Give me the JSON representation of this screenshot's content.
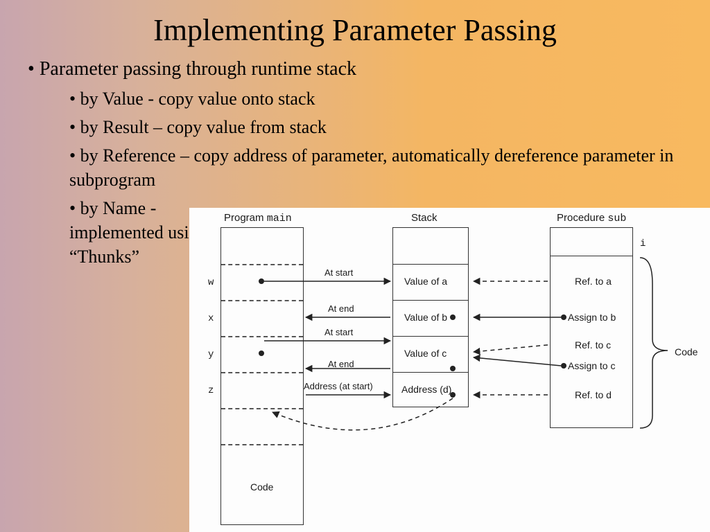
{
  "title": "Implementing Parameter Passing",
  "bullets": {
    "main": "Parameter passing through runtime stack",
    "sub": [
      "by Value - copy value onto stack",
      "by Result – copy value from stack",
      "by Reference – copy address of parameter, automatically dereference parameter in subprogram",
      "by Name - implemented using “Thunks”"
    ]
  },
  "diagram": {
    "headers": {
      "program_prefix": "Program ",
      "program_mono": "main",
      "stack": "Stack",
      "procedure_prefix": "Procedure ",
      "procedure_mono": "sub"
    },
    "main_vars": [
      "w",
      "x",
      "y",
      "z"
    ],
    "main_code_label": "Code",
    "stack_cells": [
      "Value of a",
      "Value of b",
      "Value of c",
      "Address (d)"
    ],
    "proc_i": "i",
    "proc_rows": [
      "Ref. to a",
      "Assign to b",
      "Ref. to c",
      "Assign to c",
      "Ref. to d"
    ],
    "side_code_label": "Code",
    "arrow_labels": {
      "at_start_1": "At start",
      "at_end_1": "At end",
      "at_start_2": "At start",
      "at_end_2": "At end",
      "addr_start": "Address (at start)"
    }
  }
}
